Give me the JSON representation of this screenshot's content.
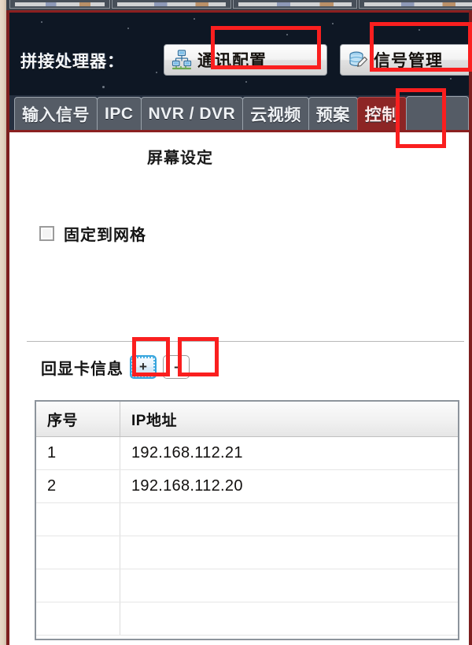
{
  "window": {
    "device_label": "拼接处理器："
  },
  "toolbar": {
    "buttons": [
      {
        "label": "通讯配置",
        "icon": "network-icon"
      },
      {
        "label": "信号管理",
        "icon": "edit-pen-icon"
      }
    ]
  },
  "tabs": [
    {
      "label": "输入信号",
      "active": false
    },
    {
      "label": "IPC",
      "active": false
    },
    {
      "label": "NVR / DVR",
      "active": false
    },
    {
      "label": "云视频",
      "active": false
    },
    {
      "label": "预案",
      "active": false
    },
    {
      "label": "控制",
      "active": true
    }
  ],
  "content": {
    "screen_settings_title": "屏幕设定",
    "snap_to_grid": {
      "label": "固定到网格",
      "checked": false
    },
    "echo_card": {
      "label": "回显卡信息",
      "add_button": "+",
      "remove_button": "-"
    },
    "ip_table": {
      "columns": [
        "序号",
        "IP地址"
      ],
      "rows": [
        {
          "index": "1",
          "ip": "192.168.112.21"
        },
        {
          "index": "2",
          "ip": "192.168.112.20"
        },
        {
          "index": "",
          "ip": ""
        },
        {
          "index": "",
          "ip": ""
        },
        {
          "index": "",
          "ip": ""
        },
        {
          "index": "",
          "ip": ""
        }
      ]
    }
  },
  "colors": {
    "header_background": "#0e1724",
    "window_border": "#7d1f1f",
    "active_tab": "#8d2525",
    "tab_background": "#555c66",
    "annotation": "#fa1f1f",
    "focus_ring": "#35a4dd",
    "desktop_strip": "#e3d2bf"
  }
}
